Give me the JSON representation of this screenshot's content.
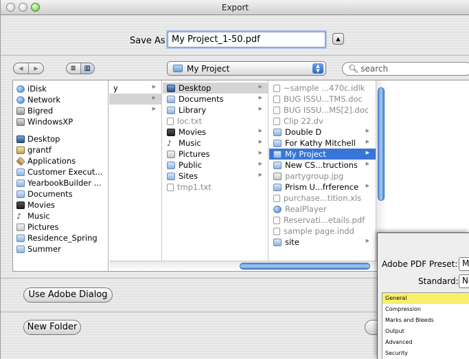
{
  "window": {
    "title": "Export"
  },
  "save": {
    "label": "Save As:",
    "filename": "My Project_1-50.pdf"
  },
  "toolbar": {
    "back_glyph": "◀",
    "forward_glyph": "▶",
    "list_view_glyph": "≣",
    "column_view_glyph": "▥",
    "location": "My Project",
    "search_placeholder": "search"
  },
  "sidebar": {
    "devices": [
      {
        "label": "iDisk",
        "icon": "idisk-icon"
      },
      {
        "label": "Network",
        "icon": "network-icon"
      },
      {
        "label": "Bigred",
        "icon": "drive-icon"
      },
      {
        "label": "WindowsXP",
        "icon": "drive-icon"
      }
    ],
    "places": [
      {
        "label": "Desktop",
        "icon": "desktop-icon"
      },
      {
        "label": "grantf",
        "icon": "home-icon"
      },
      {
        "label": "Applications",
        "icon": "applications-icon"
      },
      {
        "label": "Customer Execut...",
        "icon": "folder-icon"
      },
      {
        "label": "YearbookBuilder ...",
        "icon": "folder-icon"
      },
      {
        "label": "Documents",
        "icon": "folder-icon"
      },
      {
        "label": "Movies",
        "icon": "movies-icon"
      },
      {
        "label": "Music",
        "icon": "music-icon"
      },
      {
        "label": "Pictures",
        "icon": "pictures-icon"
      },
      {
        "label": "Residence_Spring",
        "icon": "folder-icon"
      },
      {
        "label": "Summer",
        "icon": "folder-icon"
      }
    ]
  },
  "column1": {
    "rows": [
      {
        "label": "y"
      },
      {
        "label": ""
      },
      {
        "label": ""
      }
    ]
  },
  "column2": {
    "rows": [
      {
        "label": "Desktop",
        "state": "selected-grey",
        "arrow": true,
        "icon": "desktop-icon"
      },
      {
        "label": "Documents",
        "arrow": true,
        "icon": "folder-icon"
      },
      {
        "label": "Library",
        "arrow": true,
        "icon": "folder-icon"
      },
      {
        "label": "loc.txt",
        "dim": true,
        "icon": "document-icon"
      },
      {
        "label": "Movies",
        "arrow": true,
        "icon": "movies-icon"
      },
      {
        "label": "Music",
        "arrow": true,
        "icon": "music-icon"
      },
      {
        "label": "Pictures",
        "arrow": true,
        "icon": "pictures-icon"
      },
      {
        "label": "Public",
        "arrow": true,
        "icon": "folder-icon"
      },
      {
        "label": "Sites",
        "arrow": true,
        "icon": "folder-icon"
      },
      {
        "label": "tmp1.txt",
        "dim": true,
        "icon": "document-icon"
      }
    ]
  },
  "column3": {
    "rows": [
      {
        "label": "~sample ...470c.idlk",
        "dim": true,
        "icon": "document-icon"
      },
      {
        "label": "BUG ISSU...TMS.doc",
        "dim": true,
        "icon": "document-icon"
      },
      {
        "label": "BUG ISSU...MS[2].doc",
        "dim": true,
        "icon": "document-icon"
      },
      {
        "label": "Clip 22.dv",
        "dim": true,
        "icon": "video-icon"
      },
      {
        "label": "Double D",
        "arrow": true,
        "icon": "folder-icon"
      },
      {
        "label": "For Kathy Mitchell",
        "arrow": true,
        "icon": "folder-icon"
      },
      {
        "label": "My Project",
        "state": "selected-blue",
        "arrow": true,
        "icon": "folder-icon"
      },
      {
        "label": "New CS...tructions",
        "arrow": true,
        "icon": "folder-icon"
      },
      {
        "label": "partygroup.jpg",
        "dim": true,
        "icon": "image-icon"
      },
      {
        "label": "Prism U...frference",
        "arrow": true,
        "icon": "folder-icon"
      },
      {
        "label": "purchase...tition.xls",
        "dim": true,
        "icon": "document-icon"
      },
      {
        "label": "RealPlayer",
        "dim": true,
        "icon": "realplayer-icon"
      },
      {
        "label": "Reservati...etails.pdf",
        "dim": true,
        "icon": "pdf-icon"
      },
      {
        "label": "sample page.indd",
        "dim": true,
        "icon": "indesign-icon"
      },
      {
        "label": "site",
        "arrow": true,
        "icon": "folder-icon"
      }
    ]
  },
  "buttons": {
    "use_adobe_dialog": "Use Adobe Dialog",
    "new_folder": "New Folder"
  },
  "pdf_panel": {
    "preset_label": "Adobe PDF Preset:",
    "preset_value": "Ma",
    "standard_label": "Standard:",
    "standard_value": "No",
    "categories": [
      "General",
      "Compression",
      "Marks and Bleeds",
      "Output",
      "Advanced",
      "Security"
    ],
    "active_category": "General"
  },
  "colors": {
    "selection_blue": "#3875d7",
    "selection_grey": "#d4d4d4",
    "category_highlight": "#f8ef6a"
  }
}
